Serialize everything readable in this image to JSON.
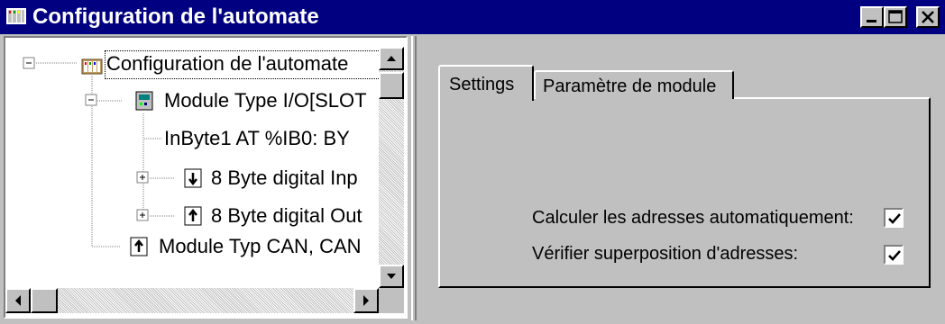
{
  "window": {
    "title": "Configuration de l'automate",
    "controls": {
      "minimize": "minimize-icon",
      "maximize": "maximize-icon",
      "close": "close-icon"
    }
  },
  "tree": {
    "nodes": [
      {
        "label": "Configuration de l'automate",
        "icon": "plc-config-icon",
        "expander": "minus",
        "selected": true
      },
      {
        "label": "Module Type I/O[SLOT",
        "icon": "io-module-icon",
        "expander": "minus"
      },
      {
        "label": "InByte1 AT %IB0: BY",
        "icon": "",
        "expander": "none"
      },
      {
        "label": "8 Byte digital Inp",
        "icon": "input-arrow-icon",
        "expander": "plus"
      },
      {
        "label": "8 Byte digital Out",
        "icon": "output-arrow-icon",
        "expander": "plus"
      },
      {
        "label": "Module Typ CAN, CAN",
        "icon": "output-arrow-icon",
        "expander": "none"
      }
    ]
  },
  "tabs": [
    {
      "label": "Settings",
      "active": true
    },
    {
      "label": "Paramètre de module",
      "active": false
    }
  ],
  "settings": {
    "auto_address_label": "Calculer les adresses automatiquement:",
    "auto_address_checked": true,
    "overlap_check_label": "Vérifier superposition d'adresses:",
    "overlap_check_checked": true
  }
}
